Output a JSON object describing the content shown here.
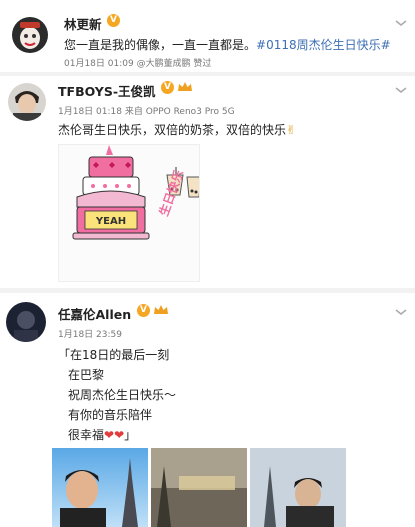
{
  "post1": {
    "username": "林更新",
    "text": "您一直是我的偶像，一直一直都是。",
    "hashtag": "#0118周杰伦生日快乐#",
    "meta": "01月18日 01:09 @大鹏董成鹏 赞过"
  },
  "post2": {
    "username": "TFBOYS-王俊凯",
    "meta": "1月18日 01:18 来自 OPPO Reno3 Pro 5G",
    "text": "杰伦哥生日快乐，双倍的奶茶，双倍的快乐",
    "drawing_caption": "生日快乐",
    "cake_word": "YEAH"
  },
  "post3": {
    "username": "任嘉伦Allen",
    "meta": "1月18日 23:59",
    "lines": [
      "「在18日的最后一刻",
      "在巴黎",
      "祝周杰伦生日快乐～",
      "有你的音乐陪伴",
      "很幸福"
    ],
    "last_line_end": "」"
  },
  "colors": {
    "verified_badge": "#f5a623",
    "hashtag": "#3d6fb4",
    "heart": "#e23b3b",
    "cake_pink": "#f06ea0"
  },
  "icons": {
    "verified": "verified-badge-icon",
    "member": "crown-icon",
    "menu": "chevron-down-icon"
  }
}
